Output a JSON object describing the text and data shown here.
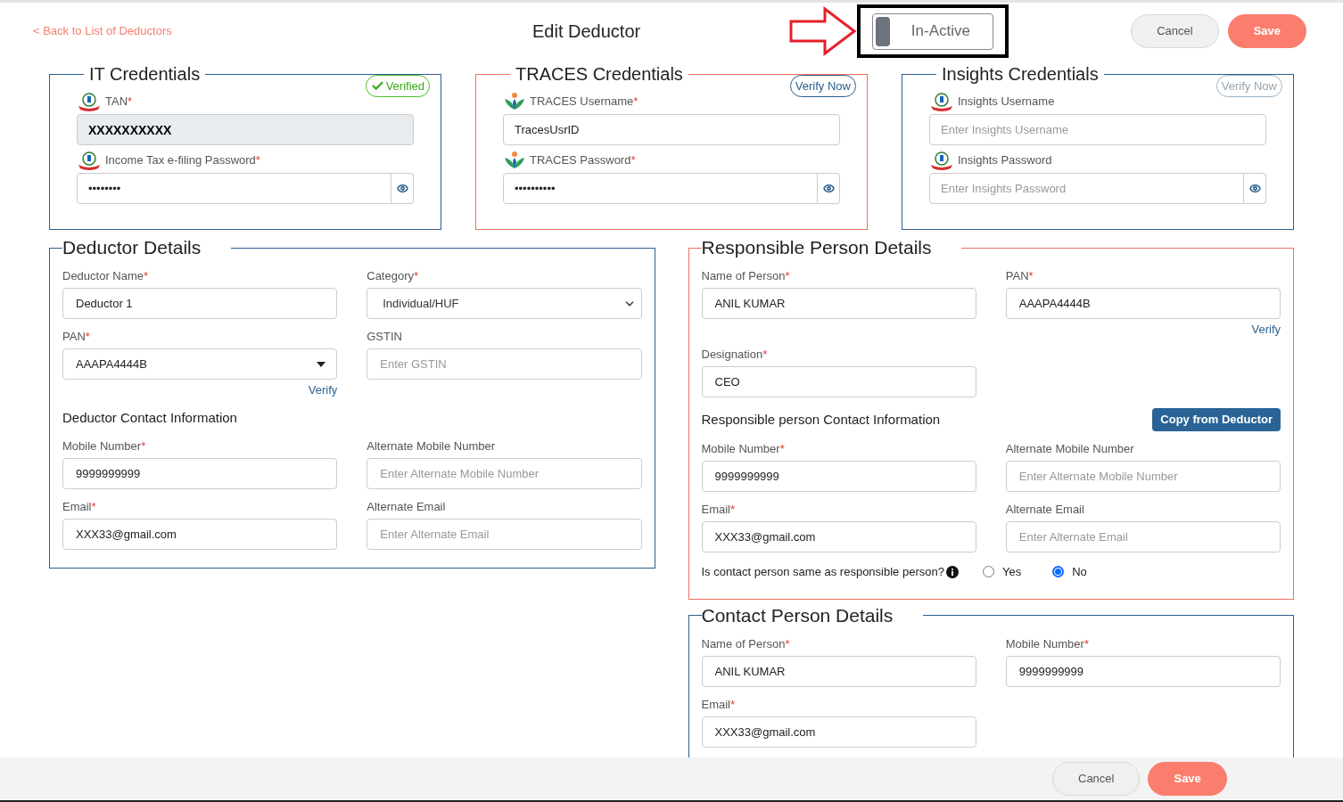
{
  "header": {
    "back_link": "< Back to List of Deductors",
    "title": "Edit Deductor",
    "status_toggle": {
      "label": "In-Active",
      "on": false
    },
    "buttons": [
      {
        "label": "Cancel",
        "kind": "secondary"
      },
      {
        "label": "Save",
        "kind": "primary"
      }
    ]
  },
  "credentials": [
    {
      "title": "IT Credentials",
      "invalid": false,
      "badge": {
        "label": "Verified",
        "kind": "verified"
      },
      "fields": [
        {
          "kind": "itd",
          "label": "TAN",
          "required_mark": "*",
          "value": "XXXXXXXXXX",
          "readonly": true,
          "password": false
        },
        {
          "kind": "itd",
          "label": "Income Tax e-filing Password",
          "required_mark": "*",
          "value": "••••••••",
          "readonly": false,
          "password": true
        }
      ]
    },
    {
      "title": "TRACES Credentials",
      "invalid": true,
      "badge": {
        "label": "Verify Now",
        "kind": "action",
        "disabled": false
      },
      "fields": [
        {
          "kind": "traces",
          "label": "TRACES Username",
          "required_mark": "*",
          "value": "TracesUsrID",
          "readonly": false,
          "password": false
        },
        {
          "kind": "traces",
          "label": "TRACES Password",
          "required_mark": "*",
          "value": "••••••••••",
          "readonly": false,
          "password": true
        }
      ]
    },
    {
      "title": "Insights Credentials",
      "invalid": false,
      "badge": {
        "label": "Verify Now",
        "kind": "action",
        "disabled": true
      },
      "fields": [
        {
          "kind": "itd",
          "label": "Insights Username",
          "placeholder": "Enter Insights Username",
          "readonly": false,
          "password": false
        },
        {
          "kind": "itd",
          "label": "Insights Password",
          "placeholder": "Enter Insights Password",
          "readonly": false,
          "password": true
        }
      ]
    }
  ],
  "left_sections": [
    {
      "title": "Deductor Details",
      "invalid": false,
      "rows": [
        {
          "kind": "fields",
          "cells": [
            {
              "label": "Deductor Name",
              "required_mark": "*",
              "kind": "text",
              "value": "Deductor 1"
            },
            {
              "label": "Category",
              "required_mark": "*",
              "kind": "select",
              "value": "Individual/HUF"
            }
          ]
        },
        {
          "kind": "fields",
          "cells": [
            {
              "label": "PAN",
              "required_mark": "*",
              "kind": "combo",
              "value": "AAAPA4444B",
              "link": "Verify"
            },
            {
              "label": "GSTIN",
              "kind": "text",
              "placeholder": "Enter GSTIN"
            }
          ]
        },
        {
          "kind": "heading",
          "text": "Deductor Contact Information"
        },
        {
          "kind": "fields",
          "cells": [
            {
              "label": "Mobile Number",
              "required_mark": "*",
              "kind": "text",
              "value": "9999999999"
            },
            {
              "label": "Alternate Mobile Number",
              "kind": "text",
              "placeholder": "Enter Alternate Mobile Number"
            }
          ]
        },
        {
          "kind": "fields",
          "cells": [
            {
              "label": "Email",
              "required_mark": "*",
              "kind": "text",
              "value": "XXX33@gmail.com"
            },
            {
              "label": "Alternate Email",
              "kind": "text",
              "placeholder": "Enter Alternate Email"
            }
          ]
        }
      ]
    }
  ],
  "right_sections": [
    {
      "title": "Responsible Person Details",
      "invalid": true,
      "rows": [
        {
          "kind": "fields",
          "cells": [
            {
              "label": "Name of Person",
              "required_mark": "*",
              "kind": "text",
              "value": "ANIL KUMAR"
            },
            {
              "label": "PAN",
              "required_mark": "*",
              "kind": "text",
              "value": "AAAPA4444B",
              "link": "Verify"
            }
          ]
        },
        {
          "kind": "fields",
          "cells": [
            {
              "label": "Designation",
              "required_mark": "*",
              "kind": "text",
              "value": "CEO"
            }
          ]
        },
        {
          "kind": "heading",
          "text": "Responsible person Contact Information",
          "button": "Copy from Deductor"
        },
        {
          "kind": "fields",
          "cells": [
            {
              "label": "Mobile Number",
              "required_mark": "*",
              "kind": "text",
              "value": "9999999999"
            },
            {
              "label": "Alternate Mobile Number",
              "kind": "text",
              "placeholder": "Enter Alternate Mobile Number"
            }
          ]
        },
        {
          "kind": "fields",
          "cells": [
            {
              "label": "Email",
              "required_mark": "*",
              "kind": "text",
              "value": "XXX33@gmail.com"
            },
            {
              "label": "Alternate Email",
              "kind": "text",
              "placeholder": "Enter Alternate Email"
            }
          ]
        },
        {
          "kind": "question",
          "text": "Is contact person same as responsible person?",
          "options": [
            {
              "label": "Yes",
              "selected": false
            },
            {
              "label": "No",
              "selected": true
            }
          ]
        }
      ]
    },
    {
      "title": "Contact Person Details",
      "invalid": false,
      "rows": [
        {
          "kind": "fields",
          "cells": [
            {
              "label": "Name of Person",
              "required_mark": "*",
              "kind": "text",
              "value": "ANIL KUMAR"
            },
            {
              "label": "Mobile Number",
              "required_mark": "*",
              "kind": "text",
              "value": "9999999999"
            }
          ]
        },
        {
          "kind": "fields",
          "cells": [
            {
              "label": "Email",
              "required_mark": "*",
              "kind": "text",
              "value": "XXX33@gmail.com"
            }
          ]
        }
      ]
    }
  ],
  "footer": {
    "buttons": [
      {
        "label": "Cancel",
        "kind": "secondary"
      },
      {
        "label": "Save",
        "kind": "primary"
      }
    ]
  }
}
